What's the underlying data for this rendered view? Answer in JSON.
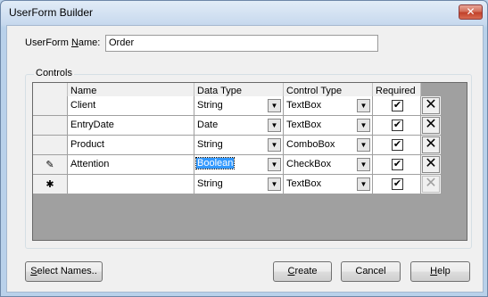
{
  "window": {
    "title": "UserForm Builder",
    "close_glyph": "✕"
  },
  "form": {
    "name_label_pre": "UserForm ",
    "name_label_accel": "N",
    "name_label_post": "ame:",
    "name_value": "Order"
  },
  "controls": {
    "group_label": "Controls",
    "columns": [
      "Name",
      "Data Type",
      "Control Type",
      "Required"
    ],
    "rows": [
      {
        "indicator": "",
        "name": "Client",
        "data_type": "String",
        "control_type": "TextBox",
        "required": "✔",
        "selected": false
      },
      {
        "indicator": "",
        "name": "EntryDate",
        "data_type": "Date",
        "control_type": "TextBox",
        "required": "✔",
        "selected": false
      },
      {
        "indicator": "",
        "name": "Product",
        "data_type": "String",
        "control_type": "ComboBox",
        "required": "✔",
        "selected": false
      },
      {
        "indicator": "✎",
        "name": "Attention",
        "data_type": "Boolean",
        "control_type": "CheckBox",
        "required": "✔",
        "selected": true
      },
      {
        "indicator": "✱",
        "name": "",
        "data_type": "String",
        "control_type": "TextBox",
        "required": "✔",
        "selected": false
      }
    ],
    "dropdown_glyph": "▼",
    "delete_glyph": "✕"
  },
  "buttons": {
    "select_names_accel": "S",
    "select_names_rest": "elect Names..",
    "create_accel": "C",
    "create_rest": "reate",
    "cancel": "Cancel",
    "help_accel": "H",
    "help_rest": "elp"
  }
}
